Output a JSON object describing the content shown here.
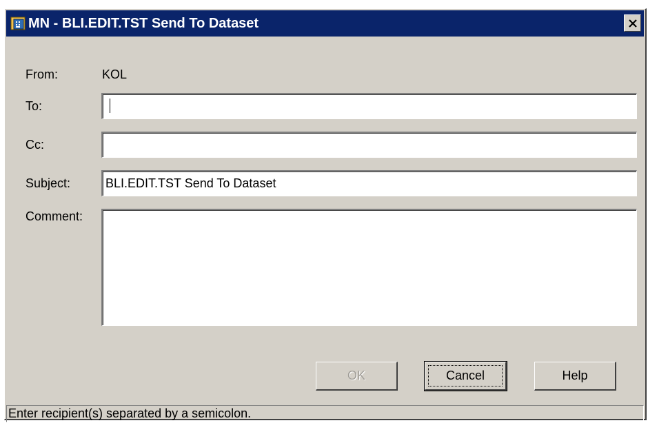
{
  "window": {
    "title": "MN - BLI.EDIT.TST Send To Dataset",
    "close_glyph": "✕",
    "icon": "app-icon"
  },
  "form": {
    "from_label": "From:",
    "from_value": "KOL",
    "to_label": "To:",
    "to_value": "",
    "cc_label": "Cc:",
    "cc_value": "",
    "subject_label": "Subject:",
    "subject_value": "BLI.EDIT.TST Send To Dataset",
    "comment_label": "Comment:",
    "comment_value": ""
  },
  "buttons": {
    "ok_label": "OK",
    "cancel_label": "Cancel",
    "help_label": "Help"
  },
  "status": {
    "text": "Enter recipient(s) separated by a semicolon."
  },
  "colors": {
    "titlebar": "#0a246a",
    "face": "#d4d0c8"
  }
}
